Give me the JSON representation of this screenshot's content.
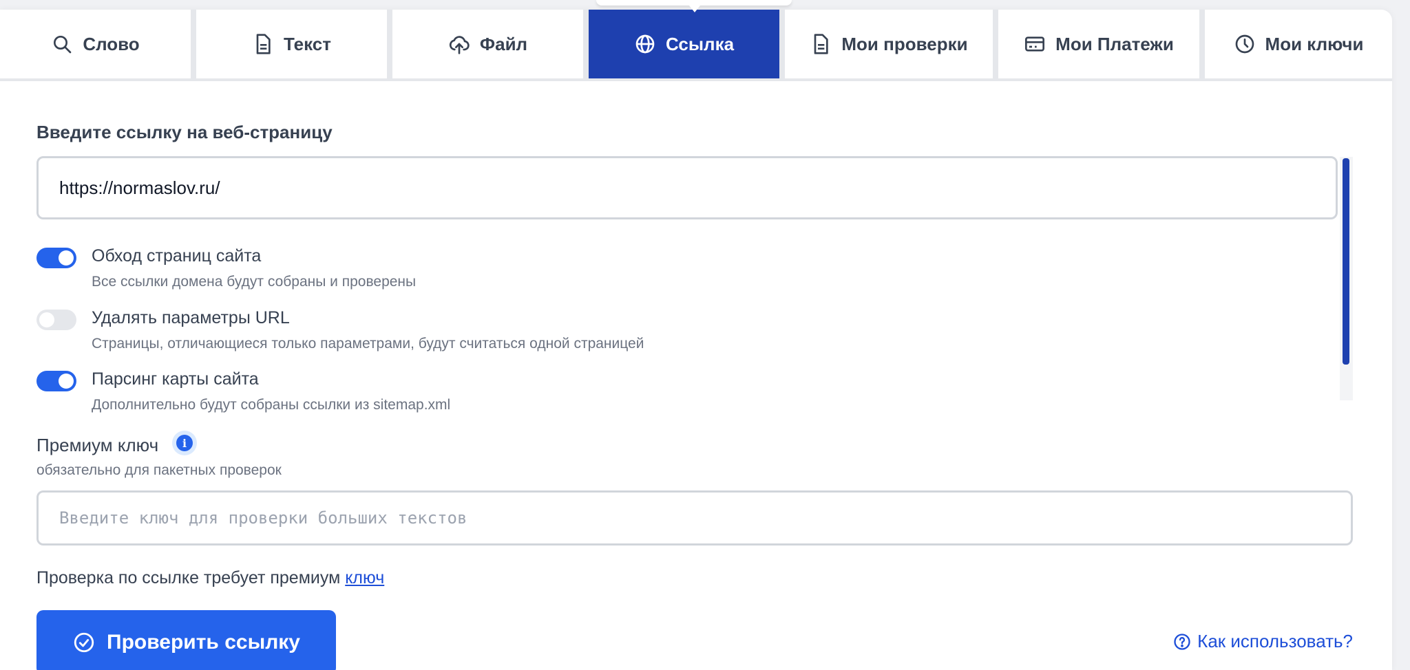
{
  "tabs": [
    {
      "label": "Слово",
      "icon": "search-icon",
      "active": false
    },
    {
      "label": "Текст",
      "icon": "document-icon",
      "active": false
    },
    {
      "label": "Файл",
      "icon": "cloud-upload-icon",
      "active": false
    },
    {
      "label": "Ссылка",
      "icon": "globe-icon",
      "active": true
    },
    {
      "label": "Мои проверки",
      "icon": "document-icon",
      "active": false
    },
    {
      "label": "Мои Платежи",
      "icon": "credit-card-icon",
      "active": false
    },
    {
      "label": "Мои ключи",
      "icon": "clock-icon",
      "active": false
    }
  ],
  "url_section": {
    "label": "Введите ссылку на веб-страницу",
    "value": "https://normaslov.ru/"
  },
  "options": [
    {
      "title": "Обход страниц сайта",
      "description": "Все ссылки домена будут собраны и проверены",
      "enabled": true
    },
    {
      "title": "Удалять параметры URL",
      "description": "Страницы, отличающиеся только параметрами, будут считаться одной страницей",
      "enabled": false
    },
    {
      "title": "Парсинг карты сайта",
      "description": "Дополнительно будут собраны ссылки из sitemap.xml",
      "enabled": true
    }
  ],
  "premium": {
    "label": "Премиум ключ",
    "subtitle": "обязательно для пакетных проверок",
    "placeholder": "Введите ключ для проверки больших текстов",
    "info_icon": "info-icon"
  },
  "note": {
    "text": "Проверка по ссылке требует премиум ",
    "link": "ключ"
  },
  "actions": {
    "submit_label": "Проверить ссылку",
    "howto_label": "Как использовать?"
  },
  "colors": {
    "active_tab": "#1e40af",
    "primary": "#2563eb",
    "link": "#1d4ed8"
  }
}
